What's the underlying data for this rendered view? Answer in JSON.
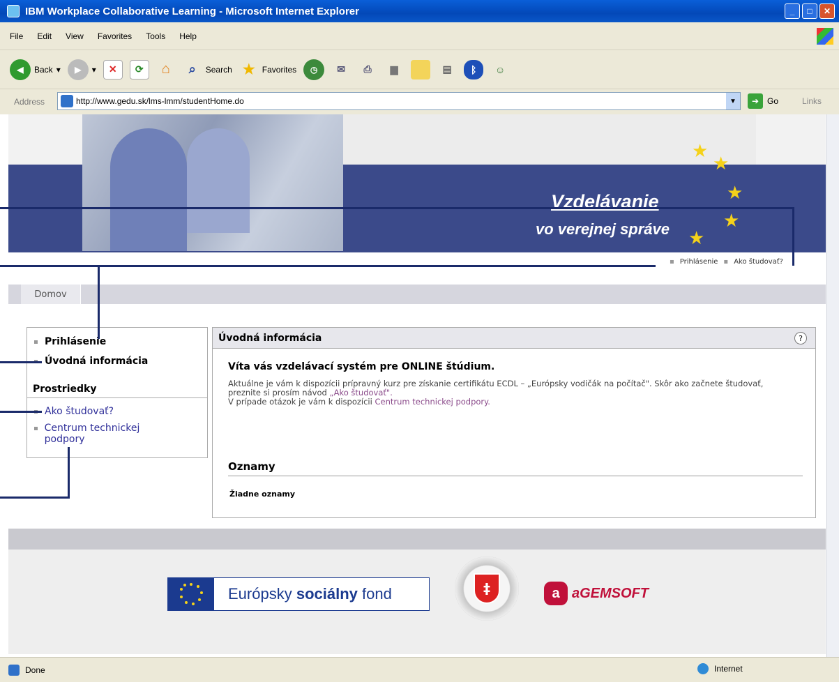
{
  "window": {
    "title": "IBM Workplace Collaborative Learning - Microsoft Internet Explorer"
  },
  "menu": [
    "File",
    "Edit",
    "View",
    "Favorites",
    "Tools",
    "Help"
  ],
  "toolbar": {
    "back": "Back",
    "search": "Search",
    "favorites": "Favorites"
  },
  "address": {
    "label": "Address",
    "url": "http://www.gedu.sk/lms-lmm/studentHome.do",
    "go": "Go",
    "links": "Links"
  },
  "banner": {
    "line1": "Vzdelávanie",
    "line2": "vo verejnej správe"
  },
  "toplinks": [
    "Prihlásenie",
    "Ako študovať?"
  ],
  "tab": {
    "label": "Domov"
  },
  "sidebar": {
    "items_top": [
      "Prihlásenie",
      "Úvodná informácia"
    ],
    "section": "Prostriedky",
    "items_bottom": [
      "Ako študovať?",
      "Centrum technickej podpory"
    ]
  },
  "main": {
    "header": "Úvodná informácia",
    "help": "?",
    "welcome": "Víta vás vzdelávací systém pre ONLINE štúdium.",
    "p1": "Aktuálne je vám k dispozícii prípravný kurz pre získanie certifikátu ECDL – „Európsky vodičák na počítač\". Skôr ako začnete študovať, preznite si prosím návod ",
    "p1_link": "„Ako študovať\".",
    "p2": "V prípade otázok je vám k dispozícii ",
    "p2_link": "Centrum technickej podpory.",
    "announcements_title": "Oznamy",
    "announcements_empty": "Žiadne oznamy"
  },
  "footer": {
    "esf_text_pre": "Európsky ",
    "esf_text_bold": "sociálny",
    "esf_text_post": " fond",
    "agem": "aGEMSOFT",
    "agem_letter": "a"
  },
  "status": {
    "left": "Done",
    "zone": "Internet"
  },
  "colors": {
    "banner_band": "#3b4a8a",
    "link": "#30309a",
    "title_blue": "#0348b8"
  }
}
